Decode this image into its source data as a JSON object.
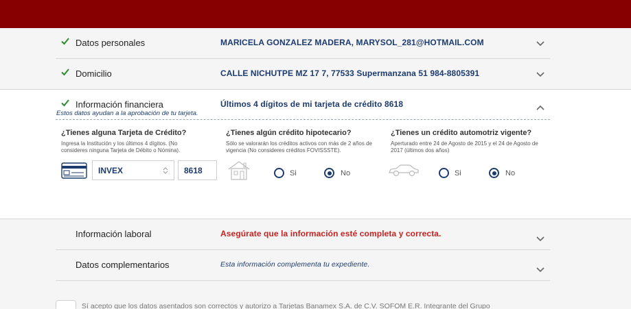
{
  "sections": {
    "personal": {
      "title": "Datos personales",
      "value": "MARICELA GONZALEZ MADERA, MARYSOL_281@HOTMAIL.COM"
    },
    "address": {
      "title": "Domicilio",
      "value": "CALLE NICHUTPE MZ 17 7, 77533 Supermanzana 51 984-8805391"
    },
    "financial": {
      "title": "Información financiera",
      "value": "Últimos 4 dígitos de mi tarjeta de crédito 8618",
      "subtitle": "Estos datos ayudan a la aprobación de tu tarjeta.",
      "credit_card": {
        "question": "¿Tienes alguna Tarjeta de Crédito?",
        "help": "Ingresa la Institución y los últimos 4 dígitos. (No consideres ninguna Tarjeta de Débito o Nómina).",
        "institution_value": "INVEX",
        "digits_value": "8618"
      },
      "mortgage": {
        "question": "¿Tienes algún crédito hipotecario?",
        "help": "Sólo se valorarán los créditos activos con más de 2 años de vigencia (No consideres créditos FOVISSSTE).",
        "yes_label": "Si",
        "no_label": "No",
        "selected": "No"
      },
      "auto": {
        "question": "¿Tienes un crédito automotriz vigente?",
        "help": "Aperturado entre 24 de Agosto de 2015 y el 24 de Agosto de 2017 (últimos dos años)",
        "yes_label": "Si",
        "no_label": "No",
        "selected": "No"
      }
    },
    "labor": {
      "title": "Información laboral",
      "value": "Asegúrate que la información esté completa y correcta."
    },
    "complementary": {
      "title": "Datos complementarios",
      "value": "Esta información complementa tu expediente."
    }
  },
  "consent": {
    "text": "Sí acepto que los datos asentados son correctos y autorizo a Tarjetas Banamex S.A. de C.V. SOFOM E.R. Integrante del Grupo"
  },
  "colors": {
    "header": "#860000",
    "accent": "#1c3b6e",
    "check": "#2e8b2e",
    "warning": "#c7221f"
  }
}
